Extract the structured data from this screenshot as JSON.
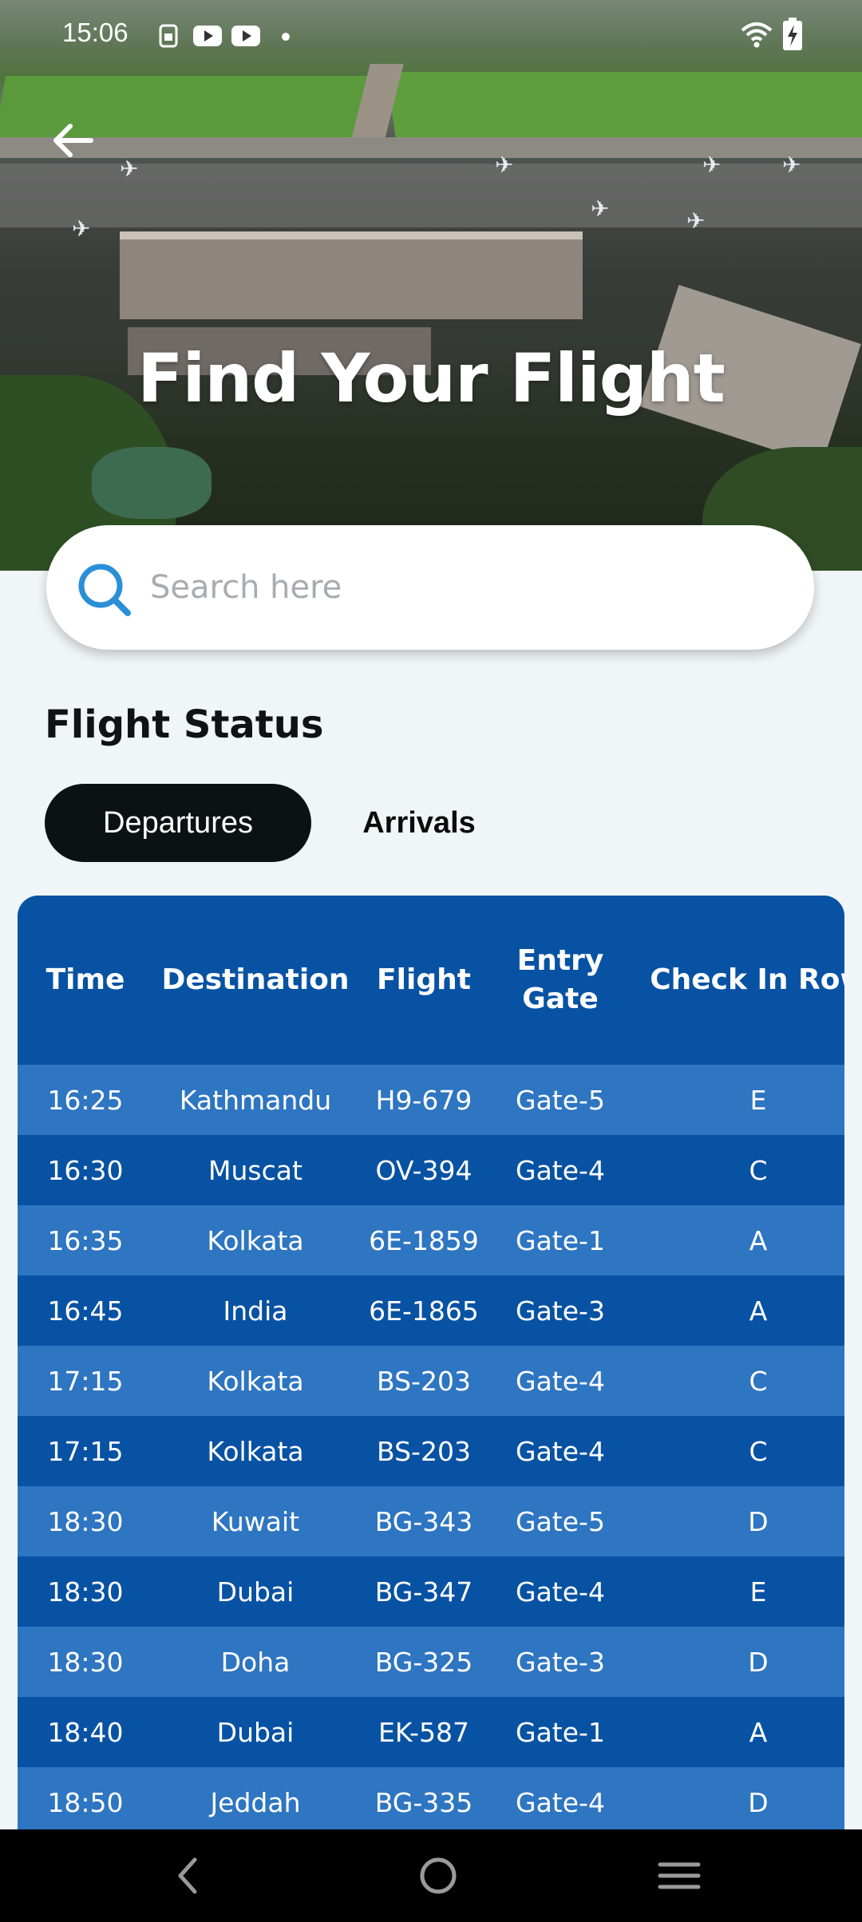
{
  "status_bar": {
    "time": "15:06",
    "left_icons": [
      "sim-icon",
      "youtube-icon",
      "youtube-icon",
      "dot-icon"
    ],
    "right_icons": [
      "wifi-icon",
      "battery-charging-icon"
    ]
  },
  "header": {
    "back_icon": "arrow-left-icon",
    "title": "Find Your Flight"
  },
  "search": {
    "icon": "search-icon",
    "placeholder": "Search here",
    "value": ""
  },
  "flight_status": {
    "title": "Flight Status",
    "tabs": [
      {
        "label": "Departures",
        "selected": true
      },
      {
        "label": "Arrivals",
        "selected": false
      }
    ]
  },
  "table": {
    "columns": [
      "Time",
      "Destination",
      "Flight",
      "Entry Gate",
      "Check In Row"
    ],
    "rows": [
      [
        "16:25",
        "Kathmandu",
        "H9-679",
        "Gate-5",
        "E"
      ],
      [
        "16:30",
        "Muscat",
        "OV-394",
        "Gate-4",
        "C"
      ],
      [
        "16:35",
        "Kolkata",
        "6E-1859",
        "Gate-1",
        "A"
      ],
      [
        "16:45",
        "India",
        "6E-1865",
        "Gate-3",
        "A"
      ],
      [
        "17:15",
        "Kolkata",
        "BS-203",
        "Gate-4",
        "C"
      ],
      [
        "17:15",
        "Kolkata",
        "BS-203",
        "Gate-4",
        "C"
      ],
      [
        "18:30",
        "Kuwait",
        "BG-343",
        "Gate-5",
        "D"
      ],
      [
        "18:30",
        "Dubai",
        "BG-347",
        "Gate-4",
        "E"
      ],
      [
        "18:30",
        "Doha",
        "BG-325",
        "Gate-3",
        "D"
      ],
      [
        "18:40",
        "Dubai",
        "EK-587",
        "Gate-1",
        "A"
      ],
      [
        "18:50",
        "Jeddah",
        "BG-335",
        "Gate-4",
        "D"
      ]
    ]
  },
  "colors": {
    "header_bg": "#0852a4",
    "row_light": "#2e75c2",
    "row_dark": "#0852a4",
    "accent": "#2b8fd8",
    "selected_tab_bg": "#0c1214"
  },
  "nav_bar": {
    "icons": [
      "nav-back-icon",
      "nav-home-icon",
      "nav-menu-icon"
    ]
  }
}
